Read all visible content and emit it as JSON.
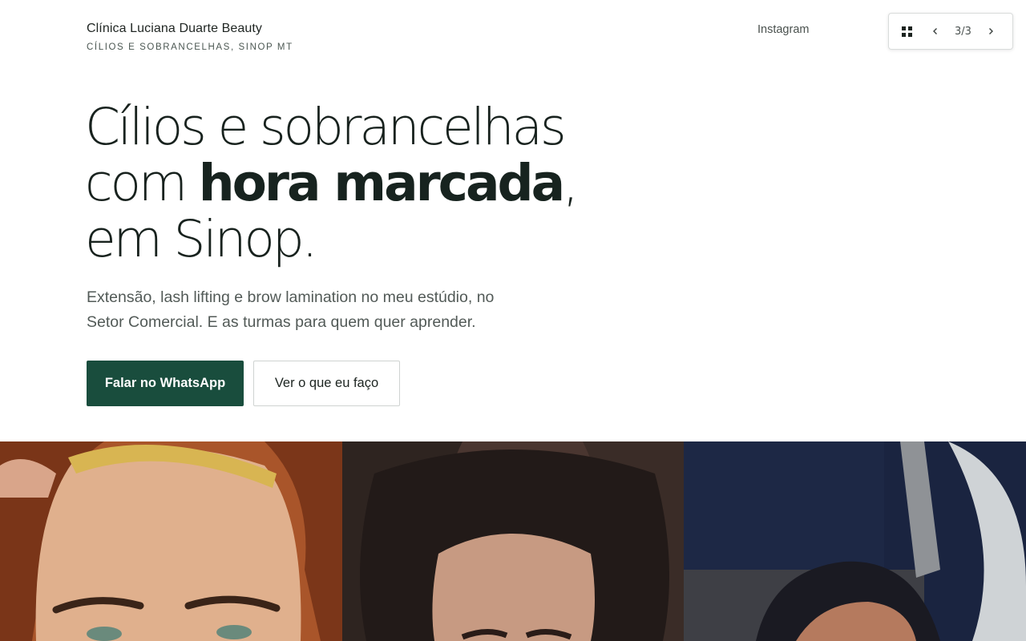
{
  "header": {
    "brand_name": "Clínica Luciana Duarte Beauty",
    "brand_tagline": "CÍLIOS E SOBRANCELHAS, SINOP MT",
    "nav_instagram": "Instagram"
  },
  "slide_controls": {
    "counter": "3/3",
    "grid_icon": "grid-icon",
    "prev_icon": "chevron-left-icon",
    "next_icon": "chevron-right-icon"
  },
  "hero": {
    "line1": "Cílios e sobrancelhas",
    "line2_pre": "com ",
    "line2_bold": "hora marcada",
    "line2_post": ",",
    "line3": "em Sinop.",
    "subtitle": "Extensão, lash lifting e brow lamination no meu estúdio, no Setor Comercial. E as turmas para quem quer aprender.",
    "primary_button": "Falar no WhatsApp",
    "secondary_button": "Ver o que eu faço"
  },
  "colors": {
    "accent": "#194d3d",
    "text_dark": "#18221e",
    "text_muted": "#525a57"
  }
}
